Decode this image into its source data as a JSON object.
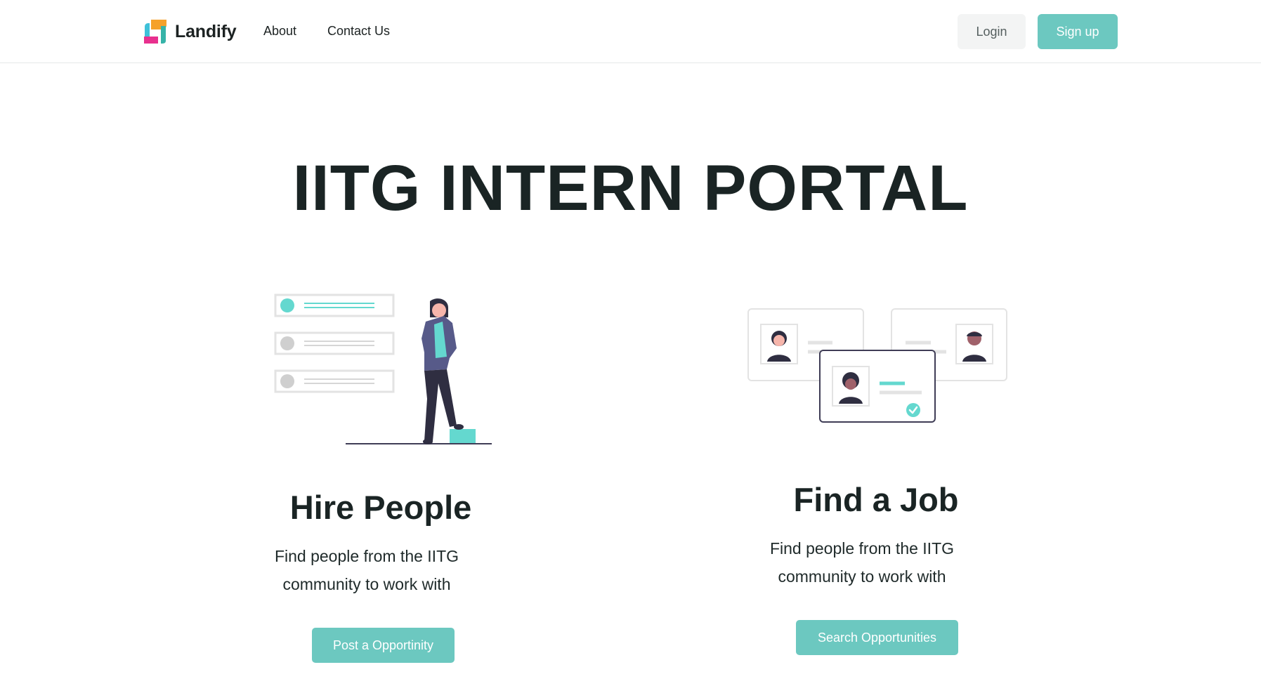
{
  "navbar": {
    "brand": "Landify",
    "links": [
      "About",
      "Contact Us"
    ],
    "login_label": "Login",
    "signup_label": "Sign up"
  },
  "hero": {
    "title": "IITG INTERN PORTAL"
  },
  "cards": [
    {
      "title": "Hire People",
      "description_line1": "Find people from the IITG",
      "description_line2": "community to work with",
      "button_label": "Post a Opportinity"
    },
    {
      "title": "Find a Job",
      "description_line1": "Find people from the IITG",
      "description_line2": "community to work with",
      "button_label": "Search Opportunities"
    }
  ],
  "colors": {
    "accent": "#6cc8c0",
    "text": "#1a2424",
    "illustration_teal": "#64d8cf",
    "illustration_dark": "#2f2e41"
  },
  "icons": [
    "landify-logo-icon",
    "checkmark-icon"
  ]
}
